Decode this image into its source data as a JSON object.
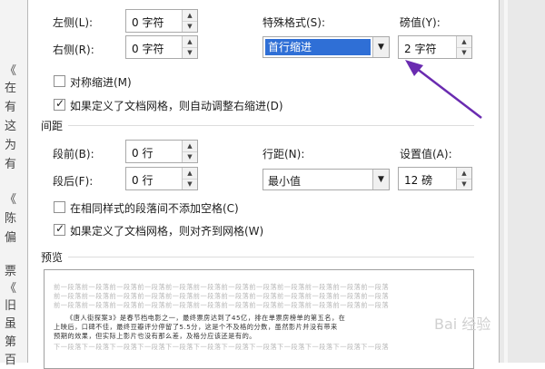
{
  "background_doc": {
    "chars": [
      "《",
      "在",
      "有",
      "这",
      "为",
      "有",
      "《",
      "陈",
      "偏",
      "票",
      "《",
      "旧",
      "虽",
      "第",
      "百"
    ]
  },
  "indent": {
    "left_label": "左侧(L):",
    "left_value": "0 字符",
    "right_label": "右侧(R):",
    "right_value": "0 字符",
    "special_label": "特殊格式(S):",
    "special_value": "首行缩进",
    "measure_label": "磅值(Y):",
    "measure_value": "2 字符",
    "mirror_label": "对称缩进(M)",
    "mirror_checked": false,
    "auto_adjust_label": "如果定义了文档网格，则自动调整右缩进(D)",
    "auto_adjust_checked": true
  },
  "spacing": {
    "section_title": "间距",
    "before_label": "段前(B):",
    "before_value": "0 行",
    "after_label": "段后(F):",
    "after_value": "0 行",
    "line_label": "行距(N):",
    "line_value": "最小值",
    "at_label": "设置值(A):",
    "at_value": "12 磅",
    "no_space_label": "在相同样式的段落间不添加空格(C)",
    "no_space_checked": false,
    "snap_grid_label": "如果定义了文档网格，则对齐到网格(W)",
    "snap_grid_checked": true
  },
  "preview": {
    "section_title": "预览",
    "lines_grey": [
      "前一段落前一段落前一段落前一段落前一段落前一段落前一段落前一段落前一段落前一段落前一段落前一段落",
      "前一段落前一段落前一段落前一段落前一段落前一段落前一段落前一段落前一段落前一段落前一段落前一段落",
      "前一段落前一段落前一段落前一段落前一段落前一段落前一段落前一段落前一段落前一段落前一段落前一段落"
    ],
    "lines_dark": [
      "《唐人街探案3》是春节档电影之一，最终票房达到了45亿，排在单票房榜单的第五名，在",
      "上映后，口碑不佳，最终豆瓣评分停留了5.5分，这是个不及格的分数，虽然影片并没有带来",
      "预期的效果，但实际上影片也没有那么差，及格分应该还是有的。"
    ],
    "lines_grey_after": [
      "下一段落下一段落下一段落下一段落下一段落下一段落下一段落下一段落下一段落下一段落下一段落下一段落"
    ]
  },
  "watermark": "Bai 经验",
  "colors": {
    "selection": "#2f6fd6",
    "annotation_arrow": "#6a2bb0"
  }
}
